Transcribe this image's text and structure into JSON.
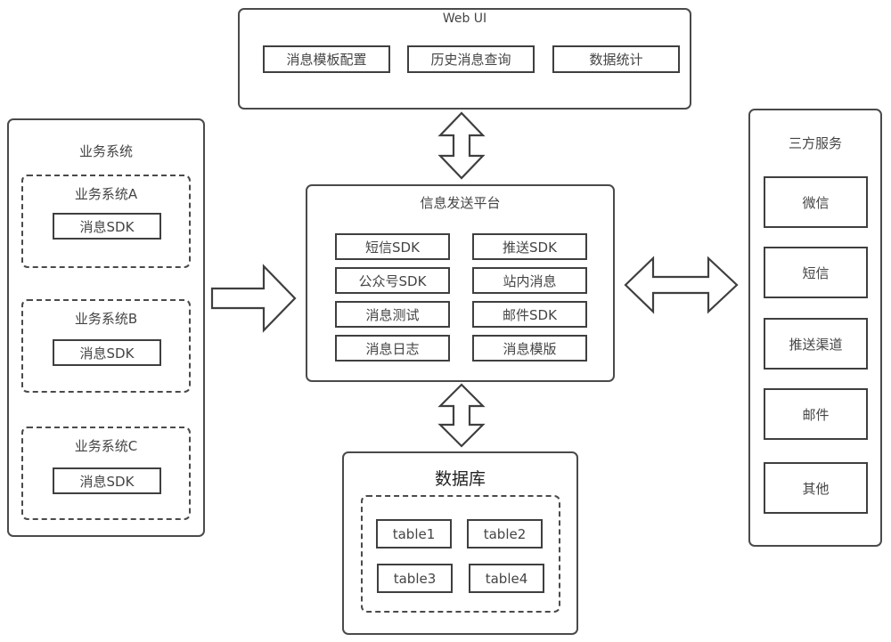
{
  "web_ui": {
    "title": "Web UI",
    "items": [
      "消息模板配置",
      "历史消息查询",
      "数据统计"
    ]
  },
  "business": {
    "title": "业务系统",
    "systems": [
      {
        "title": "业务系统A",
        "sdk": "消息SDK"
      },
      {
        "title": "业务系统B",
        "sdk": "消息SDK"
      },
      {
        "title": "业务系统C",
        "sdk": "消息SDK"
      }
    ]
  },
  "platform": {
    "title": "信息发送平台",
    "left": [
      "短信SDK",
      "公众号SDK",
      "消息测试",
      "消息日志"
    ],
    "right": [
      "推送SDK",
      "站内消息",
      "邮件SDK",
      "消息模版"
    ]
  },
  "third_party": {
    "title": "三方服务",
    "items": [
      "微信",
      "短信",
      "推送渠道",
      "邮件",
      "其他"
    ]
  },
  "database": {
    "title": "数据库",
    "tables": [
      "table1",
      "table2",
      "table3",
      "table4"
    ]
  },
  "arrows": {
    "business_to_platform": "right-arrow",
    "platform_webui": "up-down-arrow",
    "platform_database": "up-down-arrow",
    "platform_third_party": "left-right-arrow"
  }
}
